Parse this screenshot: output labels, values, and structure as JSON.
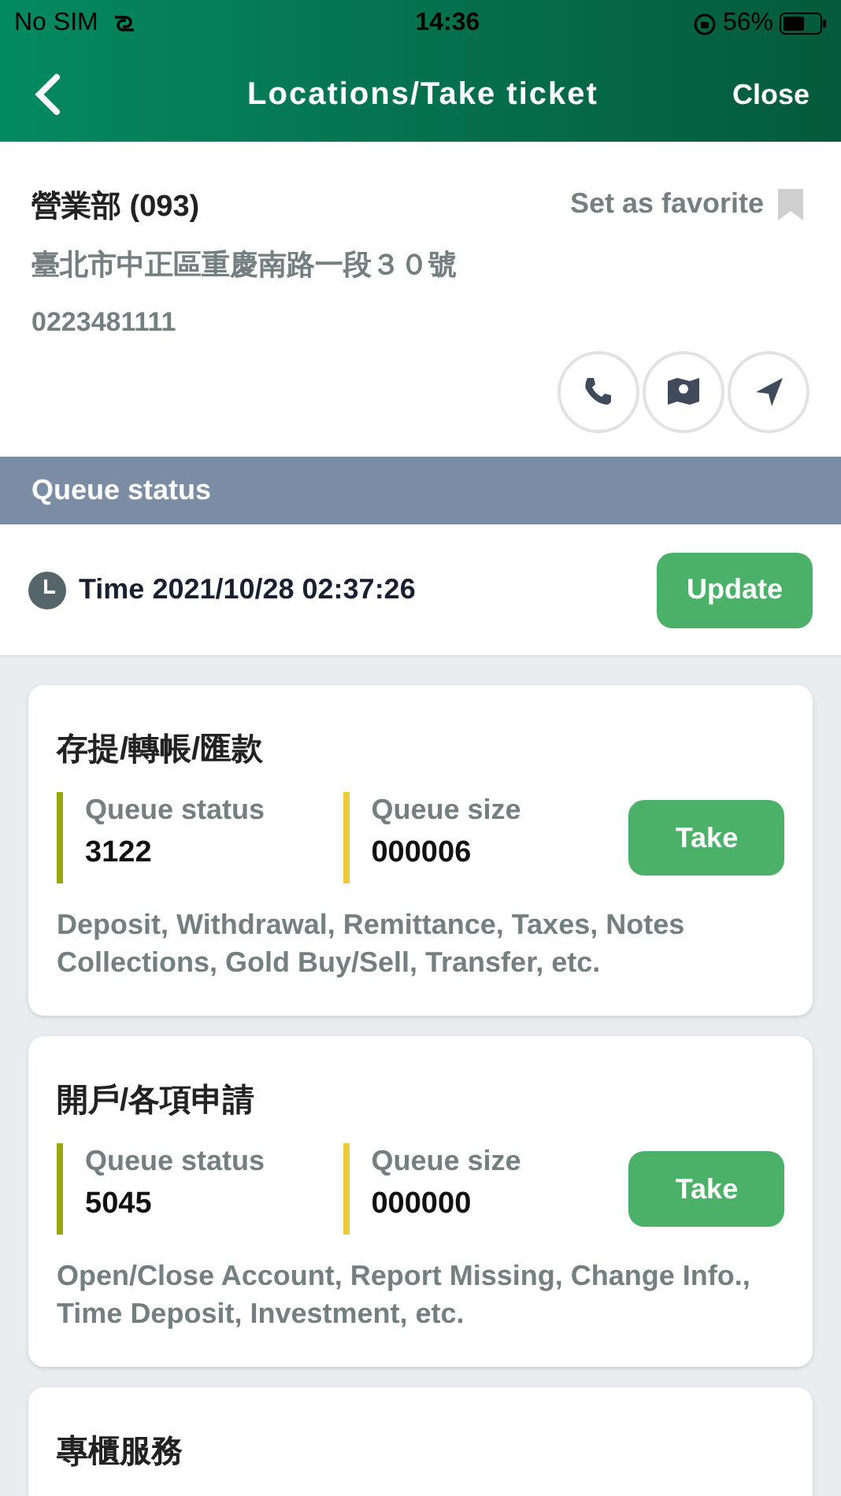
{
  "status_bar": {
    "carrier": "No SIM",
    "time": "14:36",
    "battery": "56%"
  },
  "nav": {
    "title": "Locations/Take ticket",
    "close": "Close"
  },
  "branch": {
    "name": "營業部 (093)",
    "address": "臺北市中正區重慶南路一段３０號",
    "phone": "0223481111",
    "favorite_label": "Set as favorite",
    "favorite": false
  },
  "section_title": "Queue status",
  "time_row": {
    "text": "Time 2021/10/28 02:37:26",
    "button": "Update"
  },
  "services": [
    {
      "title": "存提/轉帳/匯款",
      "status_label": "Queue status",
      "status_value": "3122",
      "size_label": "Queue size",
      "size_value": "000006",
      "button": "Take",
      "description": "Deposit, Withdrawal, Remittance, Taxes, Notes Collections, Gold Buy/Sell, Transfer, etc."
    },
    {
      "title": "開戶/各項申請",
      "status_label": "Queue status",
      "status_value": "5045",
      "size_label": "Queue size",
      "size_value": "000000",
      "button": "Take",
      "description": "Open/Close Account, Report Missing, Change Info., Time Deposit, Investment, etc."
    },
    {
      "title": "專櫃服務"
    }
  ]
}
